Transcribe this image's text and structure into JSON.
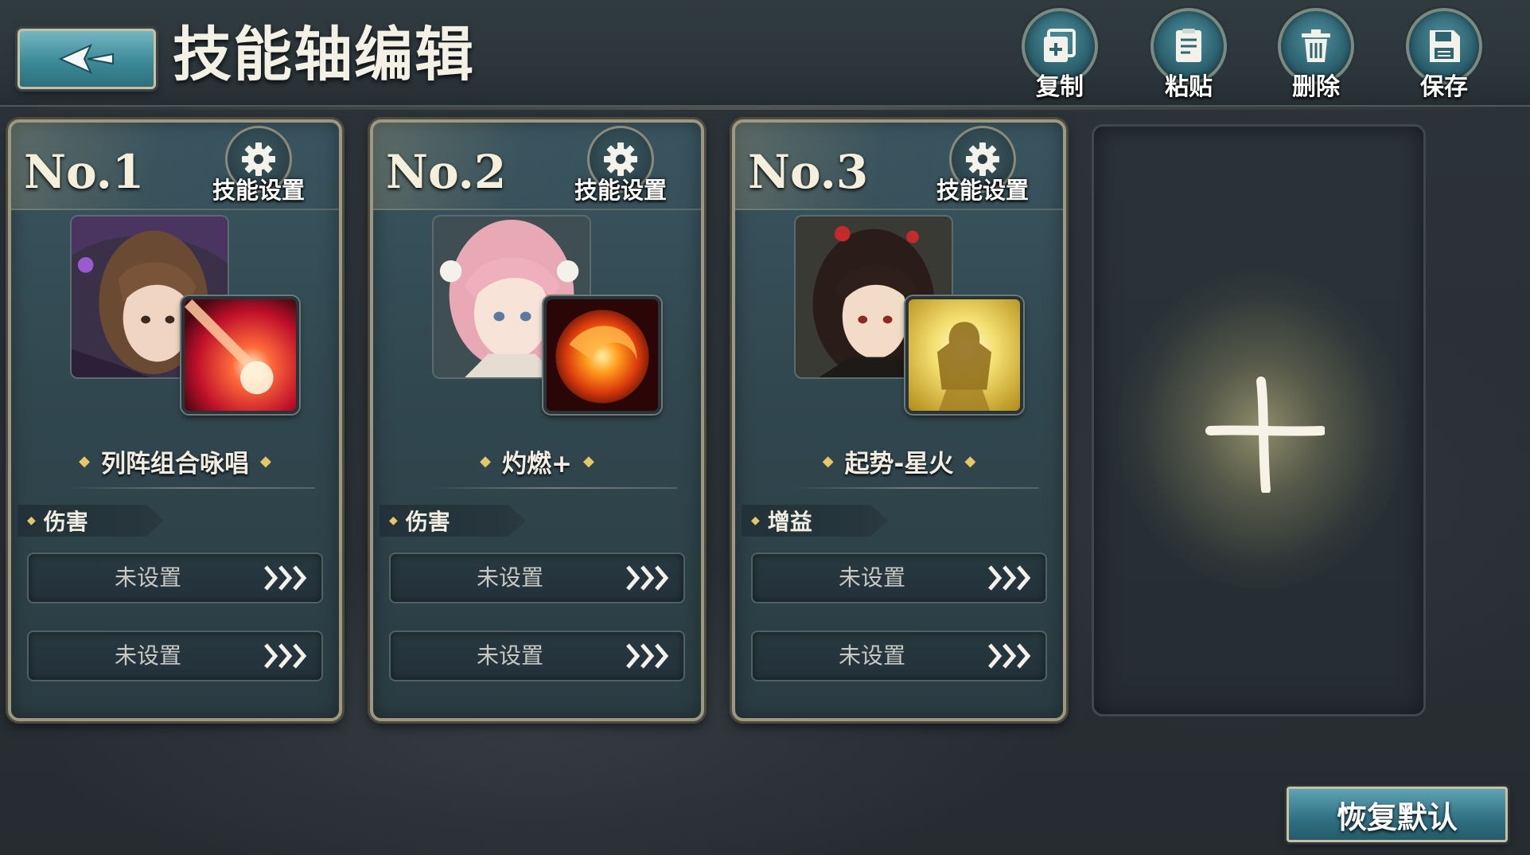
{
  "header": {
    "title": "技能轴编辑",
    "tools": [
      {
        "label": "复制",
        "icon": "copy-icon"
      },
      {
        "label": "粘贴",
        "icon": "paste-icon"
      },
      {
        "label": "删除",
        "icon": "trash-icon"
      },
      {
        "label": "保存",
        "icon": "save-icon"
      }
    ]
  },
  "cards": [
    {
      "number": "No.1",
      "settings_label": "技能设置",
      "skill_name": "列阵组合咏唱",
      "type": "伤害",
      "slots": [
        "未设置",
        "未设置"
      ]
    },
    {
      "number": "No.2",
      "settings_label": "技能设置",
      "skill_name": "灼燃+",
      "type": "伤害",
      "slots": [
        "未设置",
        "未设置"
      ]
    },
    {
      "number": "No.3",
      "settings_label": "技能设置",
      "skill_name": "起势-星火",
      "type": "增益",
      "slots": [
        "未设置",
        "未设置"
      ]
    }
  ],
  "reset_label": "恢复默认",
  "colors": {
    "accent_teal": "#3c8a99",
    "gold": "#e7c867",
    "frame": "#9e9880"
  }
}
